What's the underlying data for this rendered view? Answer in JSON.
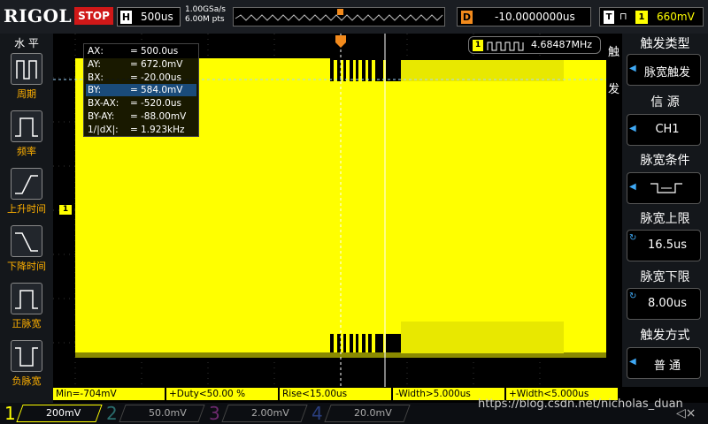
{
  "topbar": {
    "logo": "RIGOL",
    "run_status": "STOP",
    "timebase_key": "H",
    "timebase_value": "500us",
    "sample_rate": "1.00GSa/s",
    "memory_depth": "6.00M pts",
    "delay_key": "D",
    "delay_value": "-10.0000000us",
    "trigger_key": "T",
    "trigger_channel": "1",
    "trigger_level": "660mV"
  },
  "left_panel": {
    "title": "水 平",
    "items": [
      {
        "label": "周期"
      },
      {
        "label": "频率"
      },
      {
        "label": "上升时间"
      },
      {
        "label": "下降时间"
      },
      {
        "label": "正脉宽"
      },
      {
        "label": "负脉宽"
      }
    ]
  },
  "cursor_readout": {
    "rows": [
      {
        "name": "AX:",
        "value": "500.0us"
      },
      {
        "name": "AY:",
        "value": "672.0mV"
      },
      {
        "name": "BX:",
        "value": "-20.00us"
      },
      {
        "name": "BY:",
        "value": "584.0mV"
      },
      {
        "name": "BX-AX:",
        "value": "-520.0us"
      },
      {
        "name": "BY-AY:",
        "value": "-88.00mV"
      },
      {
        "name": "1/|dX|:",
        "value": "1.923kHz"
      }
    ],
    "eq": "="
  },
  "frequency_counter": {
    "channel": "1",
    "value": "4.68487MHz"
  },
  "channel_marker": "1",
  "trigger_side_label": [
    "触",
    "发"
  ],
  "right_panel": {
    "sections": [
      {
        "title": "触发类型",
        "value": "脉宽触发"
      },
      {
        "title": "信 源",
        "value": "CH1"
      },
      {
        "title": "脉宽条件",
        "value": ""
      },
      {
        "title": "脉宽上限",
        "value": "16.5us"
      },
      {
        "title": "脉宽下限",
        "value": "8.00us"
      },
      {
        "title": "触发方式",
        "value": "普 通"
      }
    ]
  },
  "measurements": [
    "Min=-704mV",
    "+Duty<50.00 %",
    "Rise<15.00us",
    "-Width>5.000us",
    "+Width<5.000us"
  ],
  "channels": [
    {
      "num": "1",
      "scale": "200mV",
      "color": "#ffff00"
    },
    {
      "num": "2",
      "scale": "50.0mV",
      "color": "#00c8c8"
    },
    {
      "num": "3",
      "scale": "2.00mV",
      "color": "#c800c8"
    },
    {
      "num": "4",
      "scale": "20.0mV",
      "color": "#2f6fff"
    }
  ],
  "watermark": "https://blog.csdn.net/nicholas_duan",
  "colors": {
    "ch1": "#ffff00",
    "trigger": "#f28a1c",
    "accent_blue": "#3fa9f5",
    "stop": "#d01818"
  }
}
